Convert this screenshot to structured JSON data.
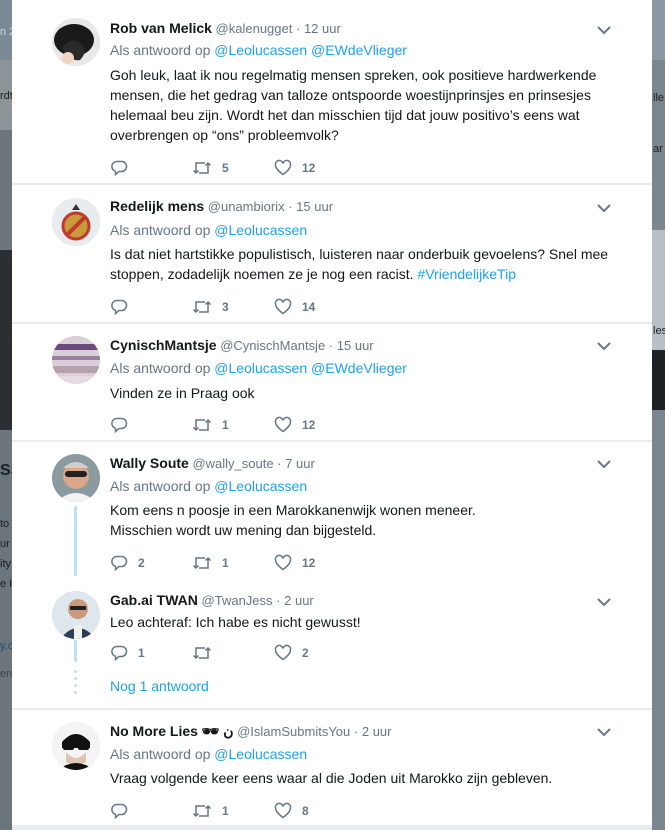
{
  "background_page": {
    "left_fragments": [
      "n 2",
      "rdt",
      "SS",
      "to",
      "ur",
      "ity",
      "e I",
      "y.c",
      "ero"
    ],
    "right_fragments": [
      "lle",
      "ar",
      "les"
    ]
  },
  "tweets": [
    {
      "name": "Rob van Melick",
      "handle": "@kalenugget",
      "time": "12 uur",
      "reply_prefix": "Als antwoord op",
      "mentions": [
        "@Leolucassen",
        "@EWdeVlieger"
      ],
      "text": "Goh leuk, laat ik nou regelmatig mensen spreken, ook positieve hardwerkende mensen, die het gedrag van talloze ontspoorde woestijnprinsjes en prinsesjes helemaal beu zijn. Wordt het dan misschien tijd dat jouw positivo’s eens wat overbrengen op “ons” probleemvolk?",
      "replies": "",
      "retweets": "5",
      "likes": "12"
    },
    {
      "name": "Redelijk mens",
      "handle": "@unambiorix",
      "time": "15 uur",
      "reply_prefix": "Als antwoord op",
      "mentions": [
        "@Leolucassen"
      ],
      "text": "Is dat niet hartstikke populistisch, luisteren naar onderbuik gevoelens? Snel mee stoppen, zodadelijk noemen ze je nog een racist. ",
      "hashtag": "#VriendelijkeTip",
      "replies": "",
      "retweets": "3",
      "likes": "14"
    },
    {
      "name": "CynischMantsje",
      "handle": "@CynischMantsje",
      "time": "15 uur",
      "reply_prefix": "Als antwoord op",
      "mentions": [
        "@Leolucassen",
        "@EWdeVlieger"
      ],
      "text": "Vinden ze in Praag ook",
      "replies": "",
      "retweets": "1",
      "likes": "12"
    },
    {
      "name": "Wally Soute",
      "handle": "@wally_soute",
      "time": "7 uur",
      "reply_prefix": "Als antwoord op",
      "mentions": [
        "@Leolucassen"
      ],
      "text_lines": [
        "Kom eens n poosje in een Marokkanenwijk wonen meneer.",
        "Misschien wordt uw mening dan bijgesteld."
      ],
      "replies": "2",
      "retweets": "1",
      "likes": "12"
    },
    {
      "name": "Gab.ai TWAN",
      "handle": "@TwanJess",
      "time": "2 uur",
      "text": "Leo achteraf: Ich habe es nicht gewusst!",
      "replies": "1",
      "retweets": "",
      "likes": "2"
    },
    {
      "name": "No More Lies",
      "name_suffix": "🕶 ن",
      "handle": "@IslamSubmitsYou",
      "time": "2 uur",
      "reply_prefix": "Als antwoord op",
      "mentions": [
        "@Leolucassen"
      ],
      "text": "Vraag volgende keer eens waar al die Joden uit Marokko zijn gebleven.",
      "replies": "",
      "retweets": "1",
      "likes": "8"
    }
  ],
  "more_replies_label": "Nog 1 antwoord",
  "dot_separator": "·",
  "icons": {
    "reply": "reply-icon",
    "retweet": "retweet-icon",
    "like": "heart-icon",
    "caret": "chevron-down-icon"
  },
  "colors": {
    "link": "#1da1f2",
    "muted": "#657786",
    "text": "#14171a",
    "thread": "#bde0f5"
  }
}
